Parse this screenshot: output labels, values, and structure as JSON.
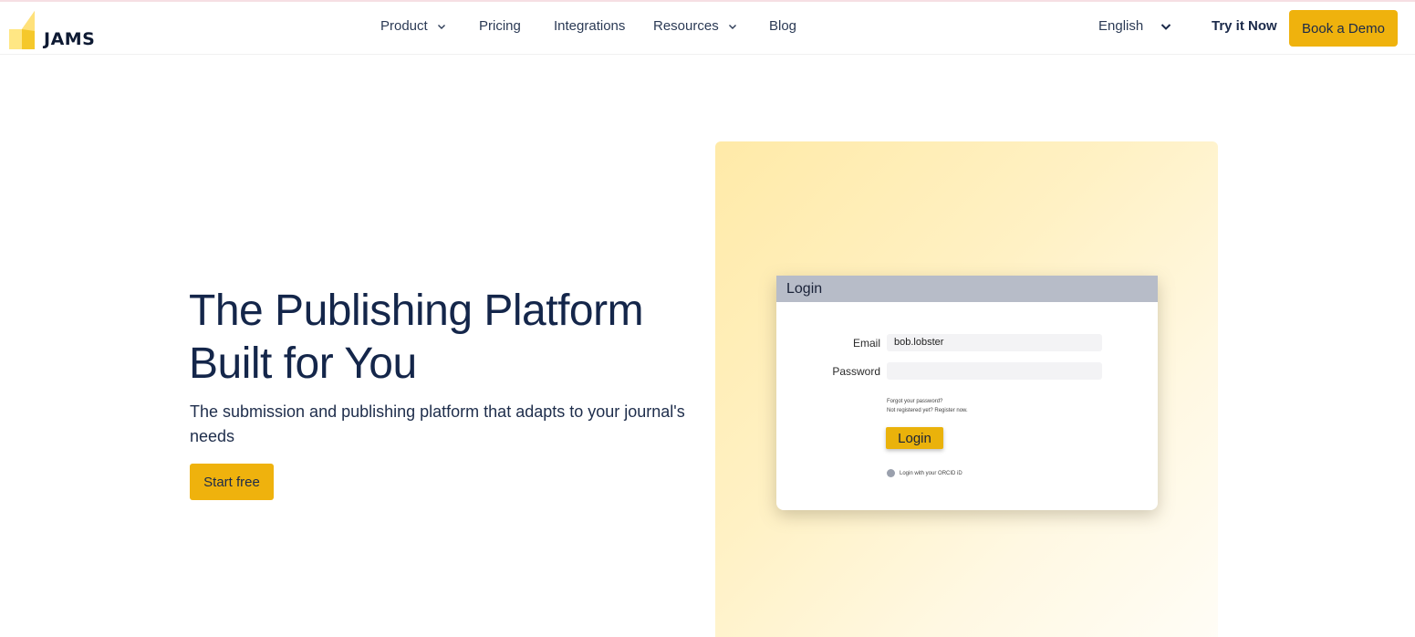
{
  "brand": {
    "name": "JAMS",
    "accent": "#efb20d"
  },
  "nav": {
    "items": [
      {
        "label": "Product",
        "has_dropdown": true
      },
      {
        "label": "Pricing",
        "has_dropdown": false
      },
      {
        "label": "Integrations",
        "has_dropdown": false
      },
      {
        "label": "Resources",
        "has_dropdown": true
      },
      {
        "label": "Blog",
        "has_dropdown": false
      }
    ],
    "language": "English",
    "try_label": "Try it Now",
    "demo_label": "Book a Demo"
  },
  "hero": {
    "title_line1": "The Publishing Platform",
    "title_line2": "Built for You",
    "subtitle": "The submission and publishing platform that adapts to your journal's needs",
    "cta_label": "Start free"
  },
  "illustration": {
    "window_title": "Login",
    "email_label": "Email",
    "email_value": "bob.lobster",
    "password_label": "Password",
    "password_value": "",
    "forgot_text": "Forgot your password?",
    "register_text": "Not registered yet? Register now.",
    "login_button": "Login",
    "orcid_text": "Login with your ORCID iD"
  }
}
